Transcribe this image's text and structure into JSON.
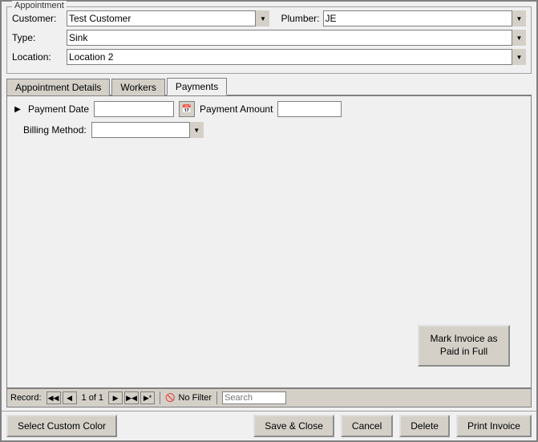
{
  "dialog": {
    "title": "Appointment"
  },
  "appointment": {
    "customer_label": "Customer:",
    "customer_value": "Test Customer",
    "plumber_label": "Plumber:",
    "plumber_value": "JE",
    "type_label": "Type:",
    "type_value": "Sink",
    "location_label": "Location:",
    "location_value": "Location 2"
  },
  "tabs": [
    {
      "id": "appointment-details",
      "label": "Appointment Details"
    },
    {
      "id": "workers",
      "label": "Workers"
    },
    {
      "id": "payments",
      "label": "Payments"
    }
  ],
  "active_tab": "payments",
  "payments": {
    "payment_date_label": "Payment Date",
    "payment_date_value": "",
    "payment_amount_label": "Payment Amount",
    "payment_amount_value": "",
    "billing_method_label": "Billing Method:",
    "billing_method_value": "",
    "mark_paid_button": "Mark Invoice as Paid in Full"
  },
  "record_nav": {
    "label": "Record:",
    "first_icon": "◀◀",
    "prev_icon": "◀",
    "record_text": "1 of 1",
    "next_icon": "▶",
    "last_icon": "▶▶",
    "new_icon": "▶*",
    "no_filter_label": "No Filter",
    "search_placeholder": "Search"
  },
  "bottom_bar": {
    "select_custom_color": "Select Custom Color",
    "save_close": "Save & Close",
    "cancel": "Cancel",
    "delete": "Delete",
    "print_invoice": "Print Invoice"
  }
}
